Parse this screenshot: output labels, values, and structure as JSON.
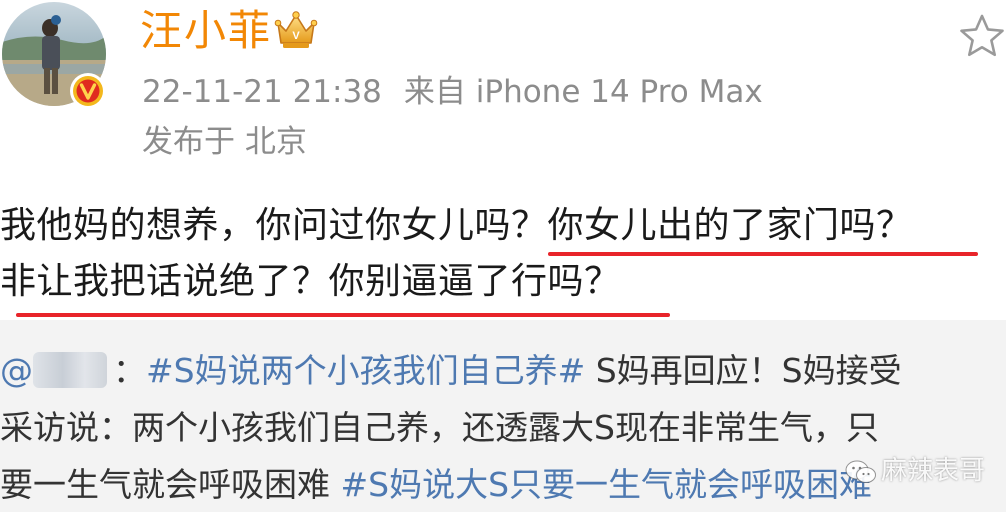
{
  "header": {
    "author_name": "汪小菲",
    "timestamp": "22-11-21 21:38",
    "source": "来自 iPhone 14 Pro Max",
    "location": "发布于 北京"
  },
  "post": {
    "line1_part1": "我他妈的想养，你问过你女儿吗？",
    "line1_part2": "你女儿出的了家门吗？",
    "line2": "非让我把话说绝了？你别逼逼了行吗？"
  },
  "repost": {
    "at_sign": "@",
    "colon": "：",
    "hashtag1": "#S妈说两个小孩我们自己养#",
    "line1_tail": " S妈再回应！S妈接受",
    "line2": "采访说：两个小孩我们自己养，还透露大S现在非常生气，只",
    "line3_head": "要一生气就会呼吸困难 ",
    "hashtag2": "#S妈说大S只要一生气就会呼吸困难"
  },
  "watermark": {
    "text": "麻辣表哥"
  },
  "colors": {
    "author_name": "#f28705",
    "underline": "#e8242a",
    "hashtag": "#4e79b1",
    "meta_text": "#8c8c8c",
    "repost_bg": "#f3f3f3"
  },
  "icons": {
    "verified": "verified-badge-icon",
    "crown": "crown-icon",
    "favorite": "star-icon",
    "watermark": "wechat-icon"
  }
}
